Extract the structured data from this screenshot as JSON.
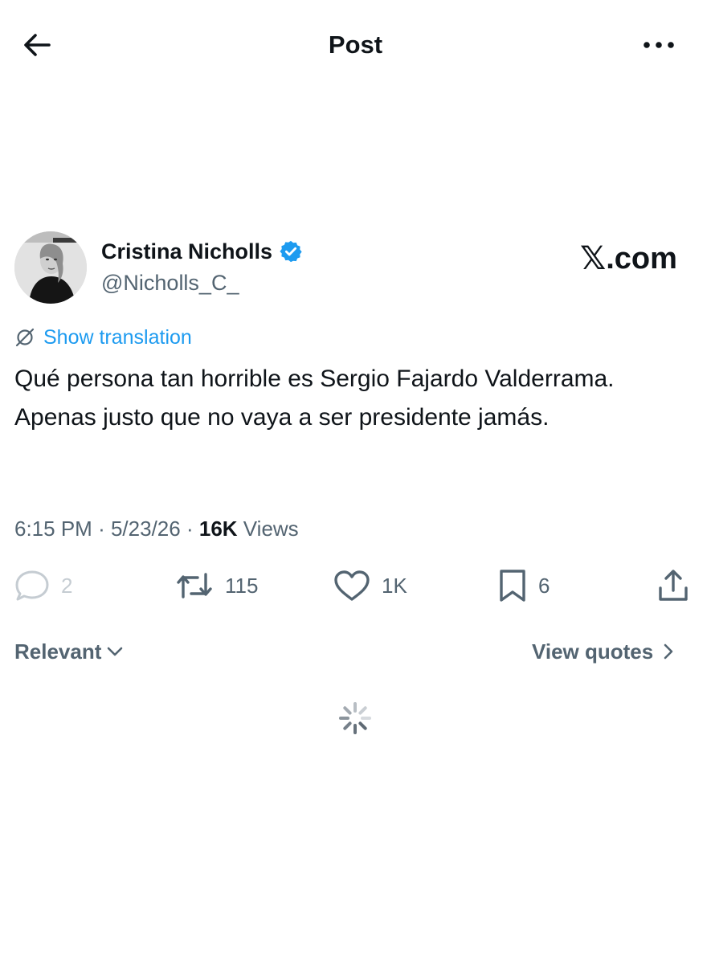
{
  "header": {
    "title": "Post",
    "back_icon": "arrow-left-icon",
    "more_icon": "more-horizontal-icon"
  },
  "author": {
    "name": "Cristina Nicholls",
    "handle": "@Nicholls_C_",
    "verified": true,
    "verified_color": "#1d9bf0"
  },
  "brand": {
    "x_mark": "𝕏",
    "suffix": ".com"
  },
  "translation": {
    "label": "Show translation",
    "icon": "globe-slash-icon"
  },
  "post": {
    "text": "Qué persona tan horrible es Sergio Fajardo Valderrama. Apenas justo que no vaya a ser presidente jamás."
  },
  "meta": {
    "time": "6:15 PM",
    "date": "5/23/26",
    "views_count": "16K",
    "views_label": "Views",
    "separator": "·"
  },
  "actions": {
    "replies": "2",
    "reposts": "115",
    "likes": "1K",
    "bookmarks": "6"
  },
  "sort": {
    "relevant_label": "Relevant",
    "quotes_label": "View quotes"
  },
  "colors": {
    "text": "#0f1419",
    "secondary": "#536471",
    "accent": "#1d9bf0",
    "disabled": "#c5ccd2"
  }
}
